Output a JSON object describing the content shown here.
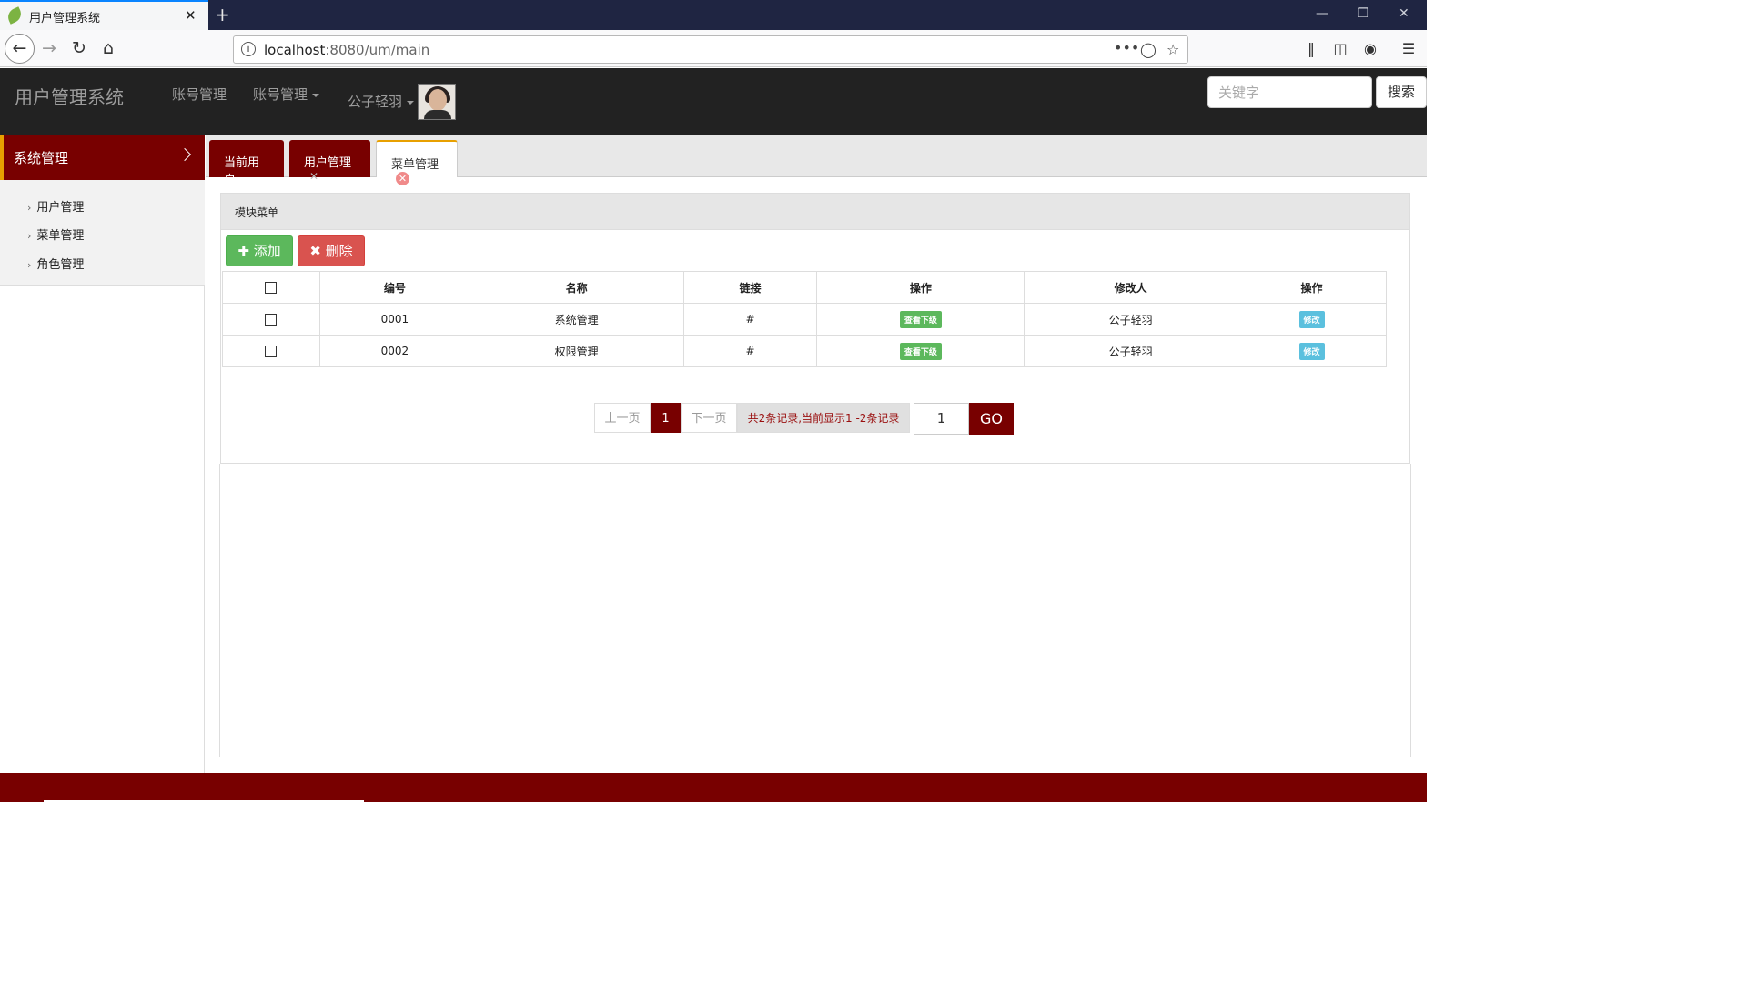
{
  "browser": {
    "tab_title": "用户管理系统",
    "tab_close": "✕",
    "new_tab": "+",
    "url_host": "localhost",
    "url_rest": ":8080/um/main",
    "url_more": "•••"
  },
  "app": {
    "brand": "用户管理系统",
    "nav": [
      "账号管理",
      "账号管理",
      "公子轻羽"
    ],
    "search_placeholder": "关键字",
    "search_button": "搜索"
  },
  "sidebar": {
    "header": "系统管理",
    "items": [
      {
        "label": "用户管理"
      },
      {
        "label": "菜单管理"
      },
      {
        "label": "角色管理"
      }
    ]
  },
  "tabs": [
    {
      "label": "当前用户",
      "closable": false
    },
    {
      "label": "用户管理",
      "closable": true
    },
    {
      "label": "菜单管理",
      "closable": true,
      "active": true
    }
  ],
  "panel": {
    "title": "模块菜单",
    "add_button": "添加",
    "delete_button": "删除",
    "columns": [
      "编号",
      "名称",
      "链接",
      "操作",
      "修改人",
      "操作"
    ],
    "rows": [
      {
        "id": "0001",
        "name": "系统管理",
        "link": "#",
        "action": "查看下级",
        "modifier": "公子轻羽",
        "edit": "修改"
      },
      {
        "id": "0002",
        "name": "权限管理",
        "link": "#",
        "action": "查看下级",
        "modifier": "公子轻羽",
        "edit": "修改"
      }
    ]
  },
  "pagination": {
    "prev": "上一页",
    "current": "1",
    "next": "下一页",
    "summary": "共2条记录,当前显示1 -2条记录",
    "page_input": "1",
    "go": "GO"
  },
  "colors": {
    "brand_dark": "#780000",
    "accent": "#e8a000",
    "header_bg": "#222222",
    "success": "#5cb85c",
    "danger": "#d9534f",
    "info": "#5bc0de"
  }
}
